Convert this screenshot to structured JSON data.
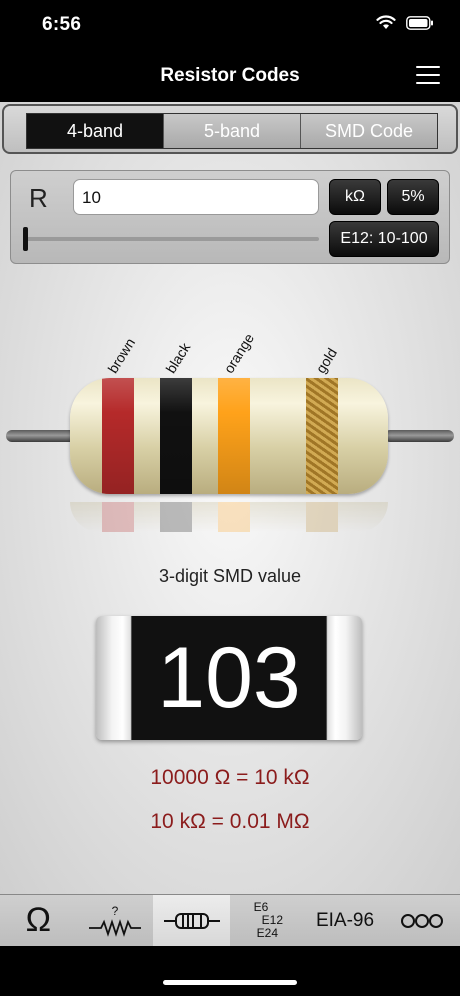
{
  "status": {
    "time": "6:56"
  },
  "header": {
    "title": "Resistor Codes"
  },
  "tabs": [
    {
      "label": "4-band",
      "active": true
    },
    {
      "label": "5-band",
      "active": false
    },
    {
      "label": "SMD Code",
      "active": false
    }
  ],
  "input": {
    "label": "R",
    "value": "10",
    "unit": "kΩ",
    "tolerance": "5%",
    "series": "E12: 10-100",
    "slider_fraction": 0.0
  },
  "resistor": {
    "bands": [
      {
        "name": "brown",
        "color": "#b52a2a"
      },
      {
        "name": "black",
        "color": "#111111"
      },
      {
        "name": "orange",
        "color": "#ffa21a"
      },
      {
        "name": "gold",
        "color": "#b8892f"
      }
    ]
  },
  "smd": {
    "caption": "3-digit SMD value",
    "code": "103",
    "result_line1": "10000 Ω = 10 kΩ",
    "result_line2": "10 kΩ = 0.01 MΩ"
  },
  "toolbar": {
    "omega": "Ω",
    "e_series": [
      "E6",
      "E12",
      "E24"
    ],
    "eia": "EIA-96",
    "more": "ooo",
    "items": [
      "ohm-icon",
      "unknown-resistor-icon",
      "resistor-icon",
      "e-series",
      "eia-96",
      "more-icon"
    ]
  }
}
